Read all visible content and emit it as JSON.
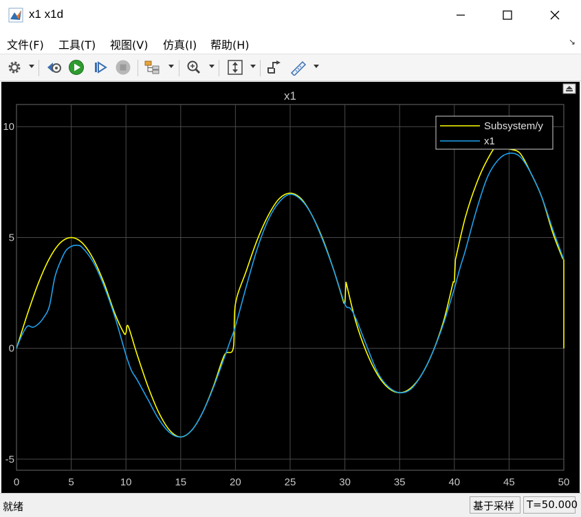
{
  "window": {
    "title": "x1 x1d",
    "minimize_icon": "minimize-icon",
    "maximize_icon": "maximize-icon",
    "close_icon": "close-icon"
  },
  "menu": {
    "items": [
      {
        "label": "文件(F)"
      },
      {
        "label": "工具(T)"
      },
      {
        "label": "视图(V)"
      },
      {
        "label": "仿真(I)"
      },
      {
        "label": "帮助(H)"
      }
    ]
  },
  "toolbar": {
    "buttons": [
      {
        "icon": "settings-gear-icon"
      },
      {
        "icon": "step-back-icon"
      },
      {
        "icon": "run-icon",
        "color": "#2e9b2e"
      },
      {
        "icon": "step-forward-icon"
      },
      {
        "icon": "stop-icon"
      },
      {
        "icon": "signal-hierarchy-icon"
      },
      {
        "icon": "zoom-icon"
      },
      {
        "icon": "scale-axes-icon"
      },
      {
        "icon": "triggers-icon"
      },
      {
        "icon": "measurements-icon"
      }
    ]
  },
  "status": {
    "left": "就绪",
    "sample_mode": "基于采样",
    "time": "T=50.000"
  },
  "chart_data": {
    "type": "line",
    "title": "x1",
    "xlim": [
      0,
      50
    ],
    "ylim": [
      -5.5,
      11
    ],
    "xticks": [
      "0",
      "5",
      "10",
      "15",
      "20",
      "25",
      "30",
      "35",
      "40",
      "45",
      "50"
    ],
    "yticks": [
      "10",
      "5",
      "0",
      "-5"
    ],
    "grid": true,
    "legend_position": "top-right",
    "background": "#000000",
    "series": [
      {
        "name": "Subsystem/y",
        "color": "#ffff00",
        "x": [
          0,
          1,
          2,
          3,
          4,
          5,
          6,
          7,
          8,
          9,
          9.8,
          10.0,
          10.2,
          11,
          12,
          13,
          14,
          15,
          16,
          17,
          18,
          19,
          19.8,
          20.0,
          21,
          22,
          23,
          24,
          25,
          26,
          27,
          28,
          29,
          29.9,
          30.0,
          30.1,
          31,
          32,
          33,
          34,
          35,
          36,
          37,
          38,
          39,
          39.9,
          40.0,
          40.1,
          41,
          42,
          43,
          44,
          45,
          46,
          47,
          48,
          49,
          49.9,
          50.0,
          50.0
        ],
        "y": [
          0,
          1.55,
          2.94,
          4.05,
          4.76,
          5.0,
          4.76,
          4.05,
          2.94,
          1.55,
          0.7,
          0.7,
          1.0,
          -0.25,
          -1.7,
          -2.9,
          -3.7,
          -4.0,
          -3.7,
          -2.9,
          -1.7,
          -0.3,
          0.0,
          2.0,
          3.5,
          4.9,
          6.0,
          6.75,
          7.0,
          6.75,
          6.0,
          4.9,
          3.5,
          2.05,
          2.0,
          3.0,
          1.2,
          -0.2,
          -1.2,
          -1.8,
          -2.0,
          -1.8,
          -1.2,
          -0.2,
          1.2,
          3.0,
          3.0,
          4.0,
          5.9,
          7.4,
          8.5,
          9.2,
          9.0,
          8.8,
          7.9,
          6.8,
          5.2,
          4.05,
          4.0,
          0.0
        ]
      },
      {
        "name": "x1",
        "color": "#1fa3f0",
        "x": [
          0,
          0.5,
          1,
          1.5,
          2,
          2.5,
          3,
          3.5,
          4,
          4.5,
          5,
          5.5,
          6,
          7,
          8,
          9,
          10,
          10.5,
          11,
          12,
          13,
          14,
          15,
          16,
          17,
          18,
          19,
          19.5,
          20,
          21,
          22,
          23,
          24,
          25,
          26,
          27,
          28,
          29,
          30,
          30.5,
          31,
          32,
          33,
          34,
          35,
          36,
          37,
          38,
          39,
          40,
          40.5,
          41,
          42,
          43,
          44,
          45,
          46,
          47,
          48,
          49,
          50
        ],
        "y": [
          0,
          0.6,
          1.0,
          0.95,
          1.1,
          1.4,
          1.9,
          3.2,
          3.9,
          4.4,
          4.6,
          4.65,
          4.55,
          3.9,
          2.8,
          1.4,
          -0.3,
          -1.0,
          -1.4,
          -2.3,
          -3.2,
          -3.8,
          -4.0,
          -3.7,
          -2.9,
          -1.75,
          -0.4,
          0.3,
          1.0,
          2.8,
          4.5,
          5.8,
          6.6,
          6.95,
          6.7,
          6.0,
          4.85,
          3.5,
          2.0,
          1.8,
          1.35,
          0.1,
          -1.1,
          -1.75,
          -2.0,
          -1.85,
          -1.2,
          -0.2,
          1.1,
          2.7,
          3.6,
          4.4,
          6.2,
          7.7,
          8.5,
          8.8,
          8.65,
          7.9,
          6.8,
          5.35,
          4.0
        ]
      }
    ]
  }
}
